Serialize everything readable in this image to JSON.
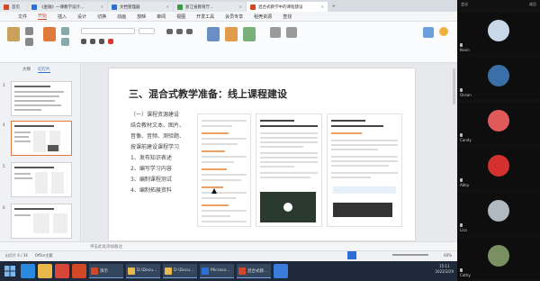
{
  "window": {
    "tabs": [
      {
        "label": "首页",
        "color": "#d24726"
      },
      {
        "label": "《金融》一课教学设计...",
        "color": "#2b6fd6"
      },
      {
        "label": "文档管理器",
        "color": "#2b6fd6"
      },
      {
        "label": "浙江省教育厅...",
        "color": "#3a9a4a"
      },
      {
        "label": "混合式教学中的课程建设",
        "color": "#d24726"
      }
    ],
    "menu": [
      "文件",
      "开始",
      "插入",
      "设计",
      "切换",
      "动画",
      "放映",
      "审阅",
      "视图",
      "开发工具",
      "会员专享",
      "稻壳资源",
      "查找"
    ],
    "menu_selected_index": 1
  },
  "leftpanel": {
    "tabs": [
      "大纲",
      "幻灯片"
    ],
    "selected_tab": 1,
    "slide_numbers": [
      "3",
      "4",
      "5",
      "6"
    ],
    "selected_slide": 1,
    "add_label": "+"
  },
  "slide": {
    "title": "三、混合式教学准备：线上课程建设",
    "bullets": [
      "（一）课程资源建设",
      "结合教材文本、图片、",
      "音像、音频、测验题、",
      "按课前建设课程学习",
      "1、发布知识表述",
      "2、编写学习内容",
      "3、编制课程测试",
      "4、编制拓展资料"
    ]
  },
  "notes": {
    "placeholder": "单击此处添加备注"
  },
  "statusbar": {
    "slide_pos": "幻灯片 4 / 34",
    "theme": "Office主题",
    "zoom": "60%"
  },
  "taskbar": {
    "windows": [
      {
        "label": "演示",
        "color": "#d24726"
      },
      {
        "label": "D:\\Docu...",
        "color": "#e8b84a"
      },
      {
        "label": "D:\\Docu...",
        "color": "#e8b84a"
      },
      {
        "label": "Microso...",
        "color": "#2b6fd6"
      },
      {
        "label": "混合式教...",
        "color": "#d24726"
      }
    ],
    "time": "15:11",
    "date": "2022/3/29"
  },
  "video_panel": {
    "header_left": "会议",
    "header_right": "成员",
    "participants": [
      {
        "name": "Kevin",
        "color": "#c8d8e8"
      },
      {
        "name": "Ocean",
        "color": "#3b6fa8"
      },
      {
        "name": "Candy",
        "color": "#e05a5a"
      },
      {
        "name": "Abby",
        "color": "#d43030"
      },
      {
        "name": "Lisa",
        "color": "#b0b8c0"
      },
      {
        "name": "Cathy",
        "color": "#7a9060"
      }
    ]
  }
}
